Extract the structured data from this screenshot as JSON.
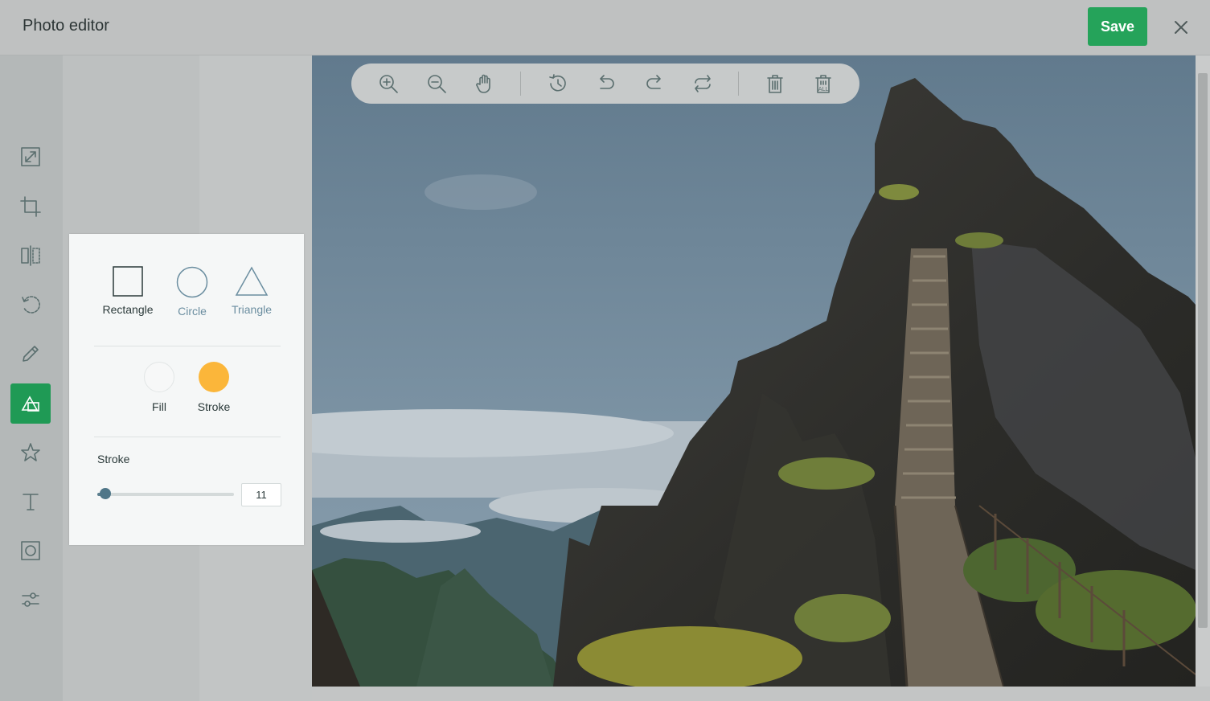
{
  "header": {
    "title": "Photo editor",
    "save_label": "Save"
  },
  "toolbar": {
    "tools": [
      "resize-icon",
      "crop-icon",
      "flip-icon",
      "rotate-icon",
      "draw-icon",
      "shape-icon",
      "star-icon",
      "text-icon",
      "mask-icon",
      "filter-icon"
    ],
    "active_tool": "shape-icon"
  },
  "canvas_toolbar": [
    "zoom-in-icon",
    "zoom-out-icon",
    "hand-icon",
    "history-icon",
    "undo-icon",
    "redo-icon",
    "reset-icon",
    "delete-icon",
    "delete-all-icon"
  ],
  "shape_panel": {
    "shapes": [
      {
        "label": "Rectangle",
        "selected": true
      },
      {
        "label": "Circle",
        "selected": false
      },
      {
        "label": "Triangle",
        "selected": false
      }
    ],
    "fill_label": "Fill",
    "stroke_color_label": "Stroke",
    "stroke_color": "#fbb63a",
    "fill_color": "#f7f8f8",
    "stroke_width_title": "Stroke",
    "stroke_width_value": "11",
    "stroke_width_fraction": 0.06
  },
  "colors": {
    "accent": "#1f9a55",
    "save": "#25a35a"
  }
}
